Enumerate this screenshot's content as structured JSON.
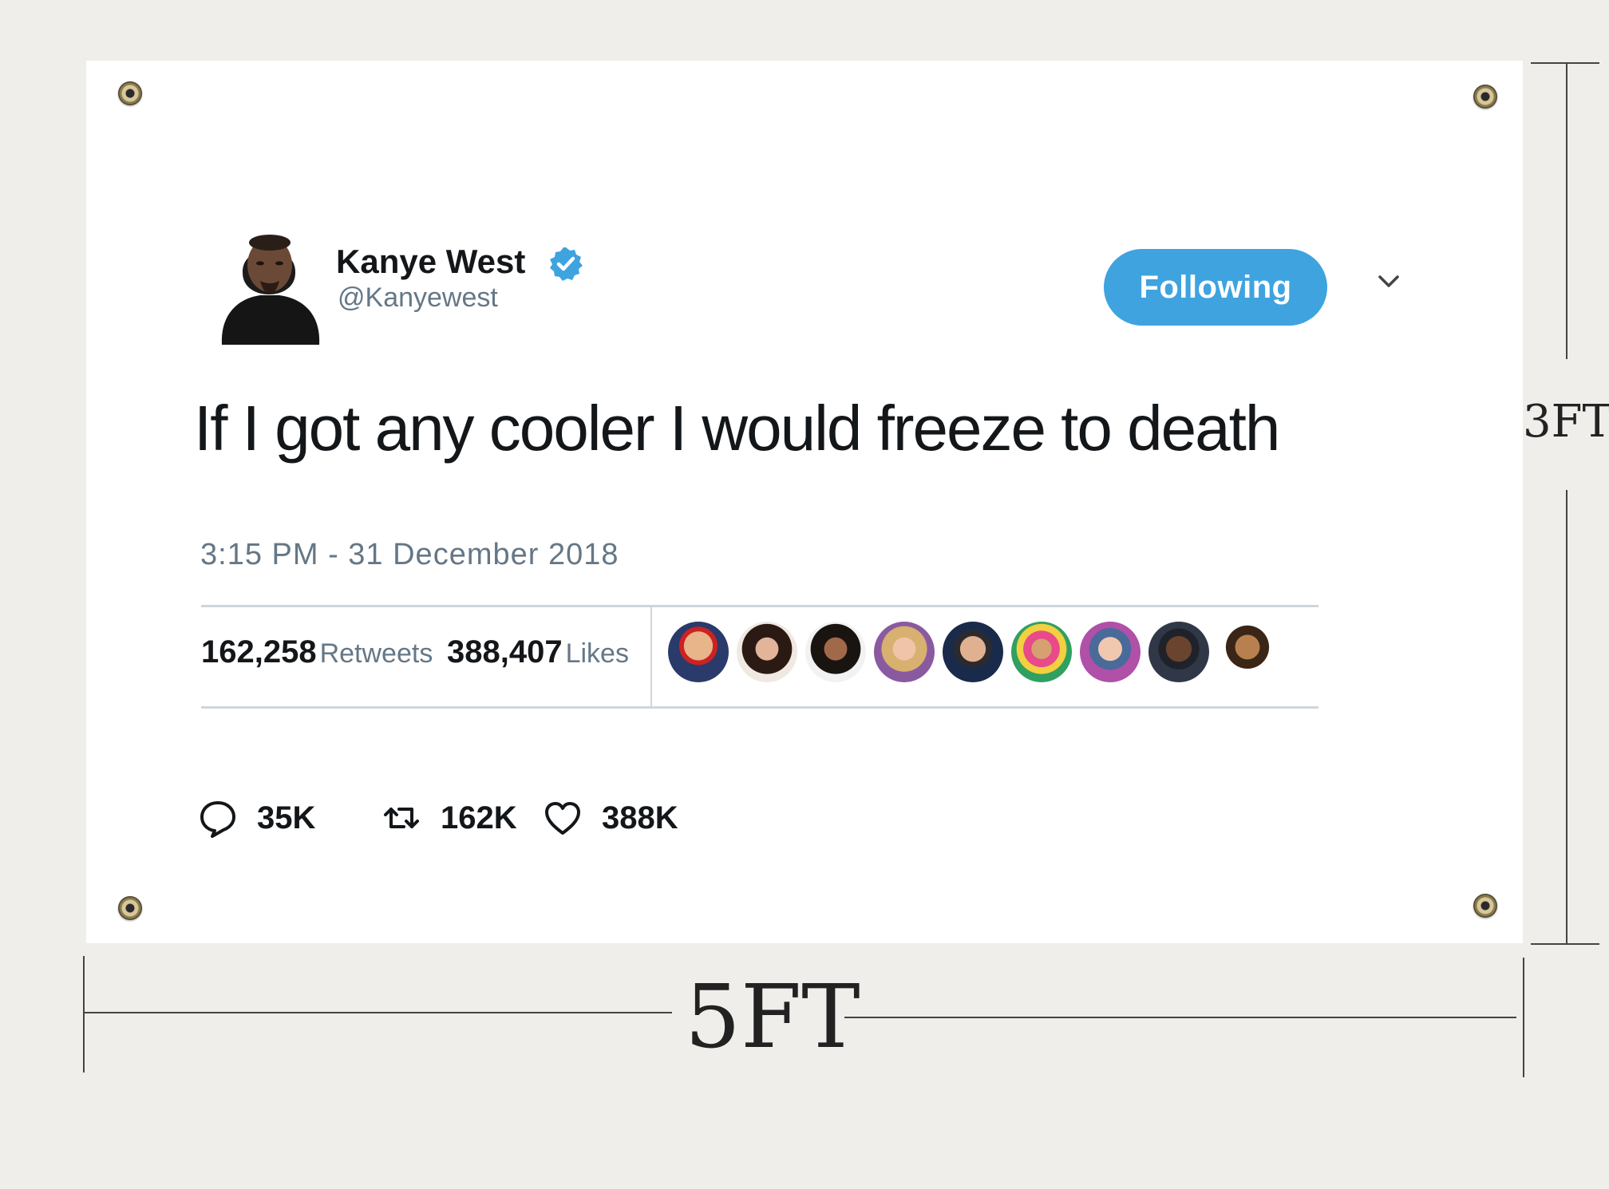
{
  "tweet": {
    "display_name": "Kanye West",
    "handle": "@Kanyewest",
    "follow_label": "Following",
    "text": "If I got any cooler I would freeze to death",
    "timestamp": "3:15 PM - 31 December 2018",
    "retweets_count": "162,258",
    "retweets_label": "Retweets",
    "likes_count": "388,407",
    "likes_label": "Likes",
    "reply_count": "35K",
    "retweet_action_count": "162K",
    "like_action_count": "388K"
  },
  "dimensions": {
    "height_label": "3FT",
    "width_label": "5FT"
  },
  "colors": {
    "follow_button": "#3fa3e0",
    "verified_badge": "#3fa3e0",
    "text_primary": "#14171a",
    "text_secondary": "#657786"
  },
  "icons": {
    "verified": "verified-badge-icon",
    "menu": "chevron-down-icon",
    "reply": "reply-bubble-icon",
    "retweet": "retweet-icon",
    "like": "heart-icon"
  }
}
